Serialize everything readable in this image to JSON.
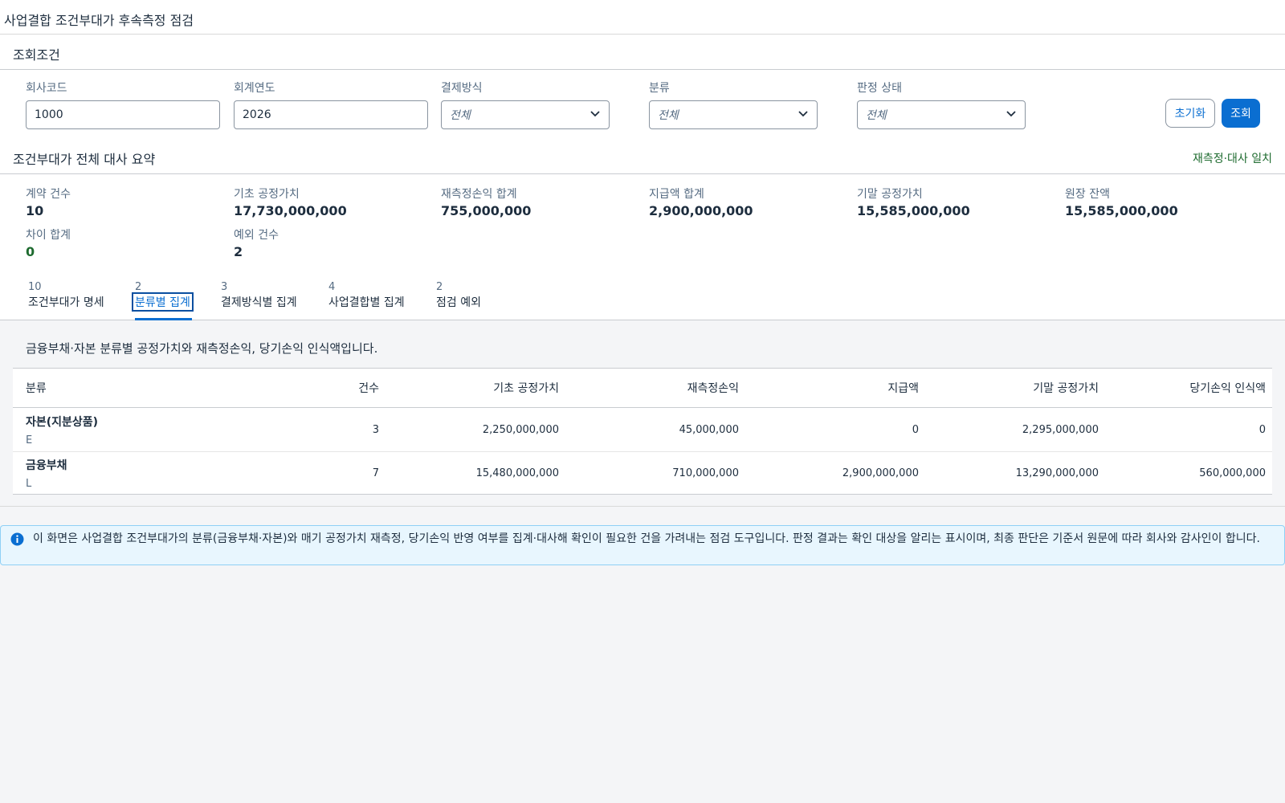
{
  "page": {
    "title": "사업결합 조건부대가 후속측정 점검"
  },
  "filters": {
    "section_title": "조회조건",
    "company_code": {
      "label": "회사코드",
      "value": "1000"
    },
    "fiscal_year": {
      "label": "회계연도",
      "value": "2026"
    },
    "settlement": {
      "label": "결제방식",
      "value": "전체"
    },
    "classification": {
      "label": "분류",
      "value": "전체"
    },
    "status": {
      "label": "판정 상태",
      "value": "전체"
    },
    "reset_label": "초기화",
    "search_label": "조회"
  },
  "summary": {
    "title": "조건부대가 전체 대사 요약",
    "status": "재측정·대사 일치",
    "metrics": [
      {
        "label": "계약 건수",
        "value": "10"
      },
      {
        "label": "기초 공정가치",
        "value": "17,730,000,000"
      },
      {
        "label": "재측정손익 합계",
        "value": "755,000,000"
      },
      {
        "label": "지급액 합계",
        "value": "2,900,000,000"
      },
      {
        "label": "기말 공정가치",
        "value": "15,585,000,000"
      },
      {
        "label": "원장 잔액",
        "value": "15,585,000,000"
      },
      {
        "label": "차이 합계",
        "value": "0"
      },
      {
        "label": "예외 건수",
        "value": "2"
      }
    ]
  },
  "tabs": [
    {
      "count": "10",
      "label": "조건부대가 명세"
    },
    {
      "count": "2",
      "label": "분류별 집계"
    },
    {
      "count": "3",
      "label": "결제방식별 집계"
    },
    {
      "count": "4",
      "label": "사업결합별 집계"
    },
    {
      "count": "2",
      "label": "점검 예외"
    }
  ],
  "active_tab": "분류별 집계",
  "content": {
    "description": "금융부채·자본 분류별 공정가치와 재측정손익, 당기손익 인식액입니다.",
    "columns": [
      "분류",
      "건수",
      "기초 공정가치",
      "재측정손익",
      "지급액",
      "기말 공정가치",
      "당기손익 인식액"
    ],
    "rows": [
      {
        "name": "자본(지분상품)",
        "code": "E",
        "count": "3",
        "opening": "2,250,000,000",
        "remeasure": "45,000,000",
        "paid": "0",
        "closing": "2,295,000,000",
        "pl": "0"
      },
      {
        "name": "금융부채",
        "code": "L",
        "count": "7",
        "opening": "15,480,000,000",
        "remeasure": "710,000,000",
        "paid": "2,900,000,000",
        "closing": "13,290,000,000",
        "pl": "560,000,000"
      }
    ]
  },
  "info": {
    "text": "이 화면은 사업결합 조건부대가의 분류(금융부채·자본)와 매기 공정가치 재측정, 당기손익 반영 여부를 집계·대사해 확인이 필요한 건을 가려내는 점검 도구입니다. 판정 결과는 확인 대상을 알리는 표시이며, 최종 판단은 기준서 원문에 따라 회사와 감사인이 합니다."
  },
  "colors": {
    "accent": "#0a6ed1",
    "success": "#1e6b2f",
    "info_bg": "#e8f6fe"
  }
}
